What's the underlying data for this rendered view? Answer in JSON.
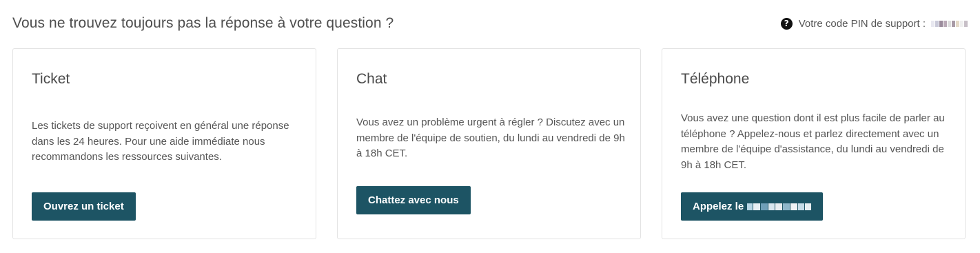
{
  "header": {
    "title": "Vous ne trouvez toujours pas la réponse à votre question ?",
    "pin_label": "Votre code PIN de support :",
    "help_icon": "question-circle-icon"
  },
  "cards": [
    {
      "title": "Ticket",
      "text": "Les tickets de support reçoivent en général une réponse dans les 24 heures. Pour une aide immédiate nous recommandons les ressources suivantes.",
      "button": "Ouvrez un ticket"
    },
    {
      "title": "Chat",
      "text": "Vous avez un problème urgent à régler ? Discutez avec un membre de l'équipe de soutien, du lundi au vendredi de 9h à 18h CET.",
      "button": "Chattez avec nous"
    },
    {
      "title": "Téléphone",
      "text": "Vous avez une question dont il est plus facile de parler au téléphone ? Appelez-nous et parlez directement avec un membre de l'équipe d'assistance, du lundi au vendredi de 9h à 18h CET.",
      "button": "Appelez le"
    }
  ],
  "colors": {
    "button_bg": "#1d5464",
    "card_border": "#e3e3e3"
  }
}
